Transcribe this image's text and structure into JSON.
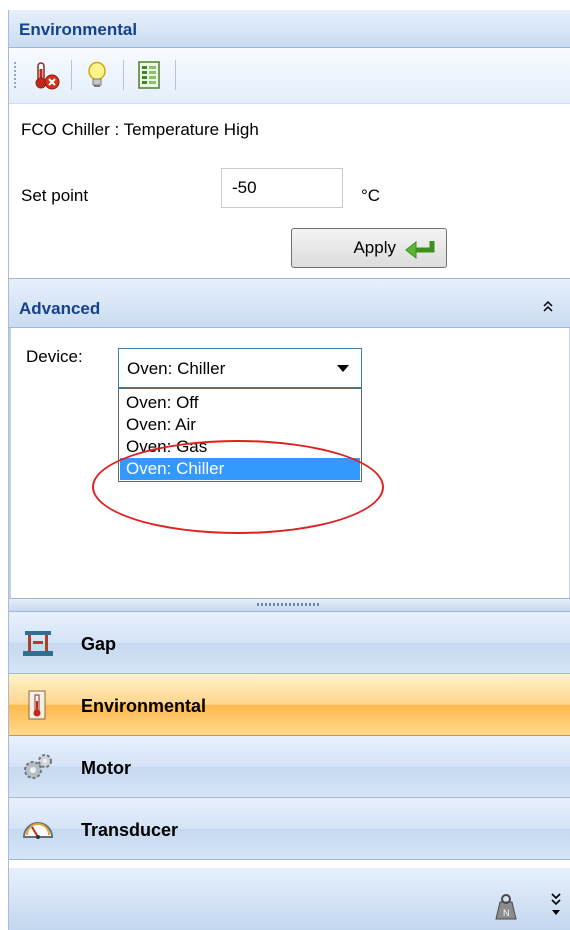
{
  "header": {
    "title": "Environmental"
  },
  "toolbar": {
    "icons": [
      "thermometer-remove-icon",
      "lightbulb-icon",
      "report-icon"
    ]
  },
  "alarm": {
    "title": "FCO Chiller : Temperature High",
    "setpoint_label": "Set point",
    "setpoint_value": "-50",
    "unit": "°C",
    "apply_label": "Apply"
  },
  "advanced": {
    "title": "Advanced",
    "device_label": "Device:",
    "device_selected": "Oven: Chiller",
    "device_options": [
      "Oven: Off",
      "Oven: Air",
      "Oven: Gas",
      "Oven: Chiller"
    ],
    "highlighted_option": "Oven: Chiller"
  },
  "nav": {
    "items": [
      {
        "label": "Gap",
        "icon": "gap-icon",
        "active": false
      },
      {
        "label": "Environmental",
        "icon": "thermometer-icon",
        "active": true
      },
      {
        "label": "Motor",
        "icon": "gears-icon",
        "active": false
      },
      {
        "label": "Transducer",
        "icon": "gauge-icon",
        "active": false
      }
    ]
  },
  "footer": {
    "icons": [
      "weight-config-icon",
      "overflow-chevron-icon"
    ]
  },
  "colors": {
    "header_text": "#15428b",
    "active_nav": "#ffb84b",
    "selected_option": "#3399ff",
    "annotation_ellipse": "#e02020"
  }
}
